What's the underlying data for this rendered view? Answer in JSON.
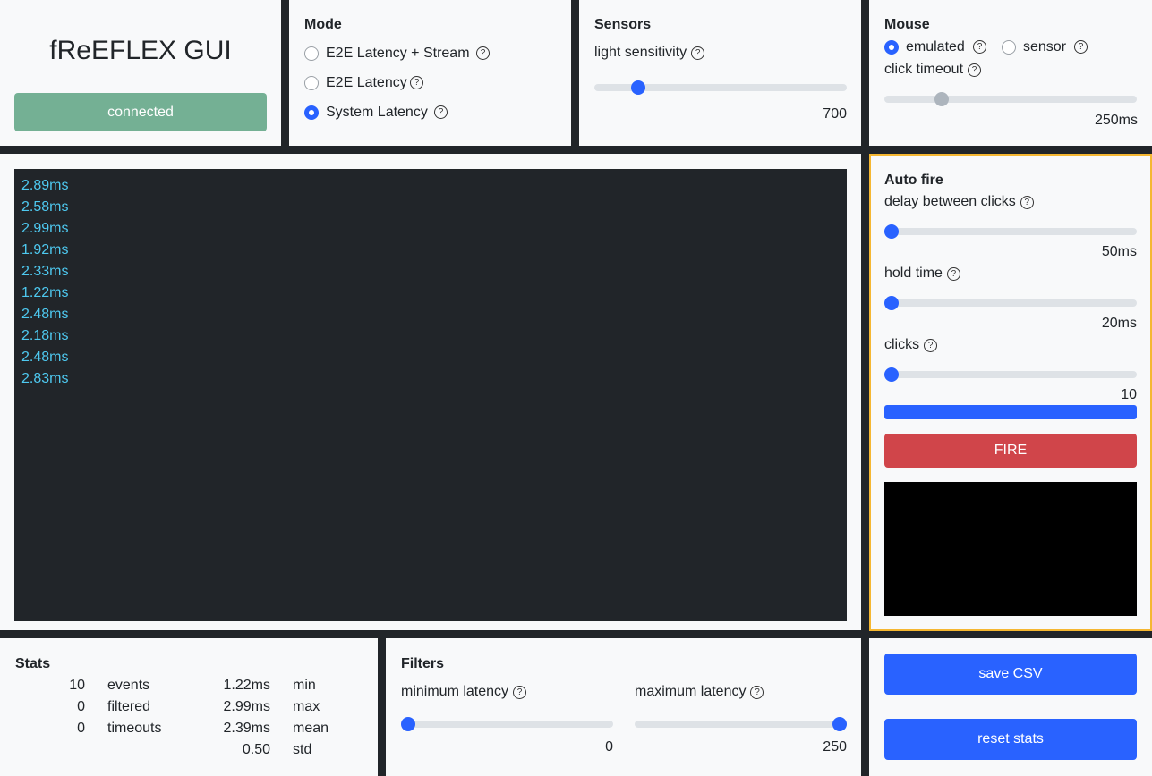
{
  "app": {
    "title": "fReEFLEX GUI",
    "status": "connected"
  },
  "mode": {
    "heading": "Mode",
    "options": [
      {
        "label": "E2E Latency + Stream",
        "selected": false
      },
      {
        "label": "E2E Latency",
        "selected": false
      },
      {
        "label": "System Latency",
        "selected": true
      }
    ]
  },
  "sensors": {
    "heading": "Sensors",
    "label": "light sensitivity",
    "value": "700"
  },
  "mouse": {
    "heading": "Mouse",
    "opt_emulated": "emulated",
    "opt_sensor": "sensor",
    "selected": "emulated",
    "timeout_label": "click timeout",
    "timeout_value": "250ms"
  },
  "log": [
    "2.89ms",
    "2.58ms",
    "2.99ms",
    "1.92ms",
    "2.33ms",
    "1.22ms",
    "2.48ms",
    "2.18ms",
    "2.48ms",
    "2.83ms"
  ],
  "autofire": {
    "heading": "Auto fire",
    "delay_label": "delay between clicks",
    "delay_value": "50ms",
    "hold_label": "hold time",
    "hold_value": "20ms",
    "clicks_label": "clicks",
    "clicks_value": "10",
    "progress": 1.0,
    "fire_label": "FIRE"
  },
  "stats": {
    "heading": "Stats",
    "rows": [
      {
        "count": "10",
        "count_label": "events",
        "ms": "1.22ms",
        "ms_label": "min"
      },
      {
        "count": "0",
        "count_label": "filtered",
        "ms": "2.99ms",
        "ms_label": "max"
      },
      {
        "count": "0",
        "count_label": "timeouts",
        "ms": "2.39ms",
        "ms_label": "mean"
      },
      {
        "count": "",
        "count_label": "",
        "ms": "0.50",
        "ms_label": "std"
      }
    ]
  },
  "filters": {
    "heading": "Filters",
    "min_label": "minimum latency",
    "min_value": "0",
    "max_label": "maximum latency",
    "max_value": "250"
  },
  "actions": {
    "save": "save CSV",
    "reset": "reset stats"
  },
  "colors": {
    "accent": "#2962ff",
    "connected": "#74b094",
    "fire": "#d0454a",
    "autofire_border": "#f5b731",
    "log_text": "#4ec9f0"
  }
}
